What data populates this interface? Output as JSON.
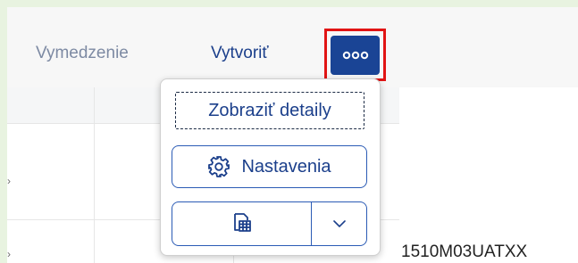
{
  "toolbar": {
    "vymedzenie_label": "Vymedzenie",
    "vytvorit_label": "Vytvoriť",
    "overflow_icon": "more-dots-icon"
  },
  "popover": {
    "detaily_label": "Zobraziť detaily",
    "nastavenia_label": "Nastavenia",
    "nastavenia_icon": "gear-icon",
    "export_icon": "spreadsheet-export-icon",
    "dropdown_icon": "chevron-down-icon"
  },
  "table": {
    "row_chevron": "›"
  },
  "status": {
    "label": "1510M03UATXX"
  },
  "colors": {
    "accent": "#1a4495",
    "highlight_border": "#e11414",
    "button_text": "#1b3f8b",
    "disabled_text": "#7d8aa3"
  }
}
